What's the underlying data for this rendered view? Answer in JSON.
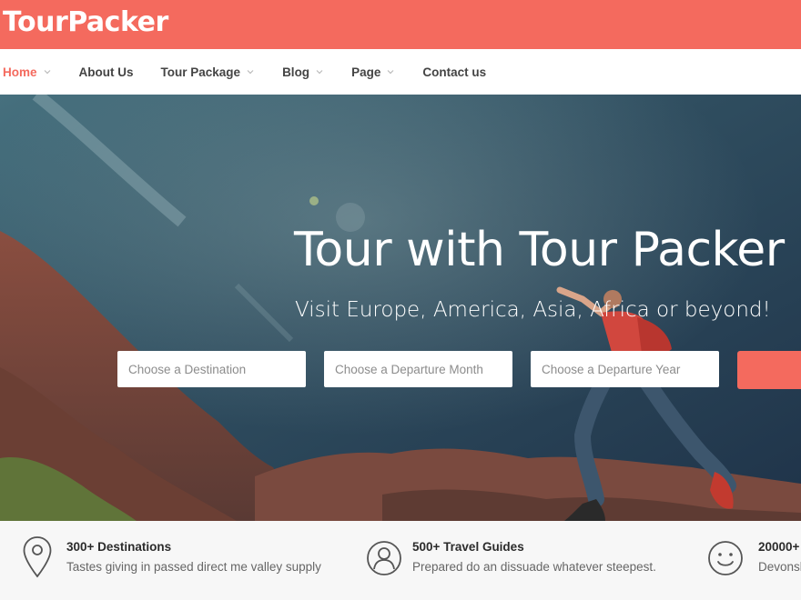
{
  "brand": {
    "name": "TourPacker",
    "color": "#f46a5e"
  },
  "nav": {
    "items": [
      {
        "label": "Home",
        "active": true,
        "has_dropdown": true
      },
      {
        "label": "About Us",
        "active": false,
        "has_dropdown": false
      },
      {
        "label": "Tour Package",
        "active": false,
        "has_dropdown": true
      },
      {
        "label": "Blog",
        "active": false,
        "has_dropdown": true
      },
      {
        "label": "Page",
        "active": false,
        "has_dropdown": true
      },
      {
        "label": "Contact us",
        "active": false,
        "has_dropdown": false
      }
    ]
  },
  "hero": {
    "title": "Tour with Tour Packer",
    "subtitle": "Visit Europe, America, Asia, Africa or beyond!"
  },
  "search": {
    "destination_placeholder": "Choose a Destination",
    "month_placeholder": "Choose a Departure Month",
    "year_placeholder": "Choose a Departure Year"
  },
  "features": [
    {
      "icon": "map-pin-icon",
      "title": "300+ Destinations",
      "desc": "Tastes giving in passed direct me valley supply"
    },
    {
      "icon": "guide-person-icon",
      "title": "500+ Travel Guides",
      "desc": "Prepared do an dissuade whatever steepest."
    },
    {
      "icon": "smiley-icon",
      "title": "20000+",
      "desc": "Devonsh"
    }
  ]
}
